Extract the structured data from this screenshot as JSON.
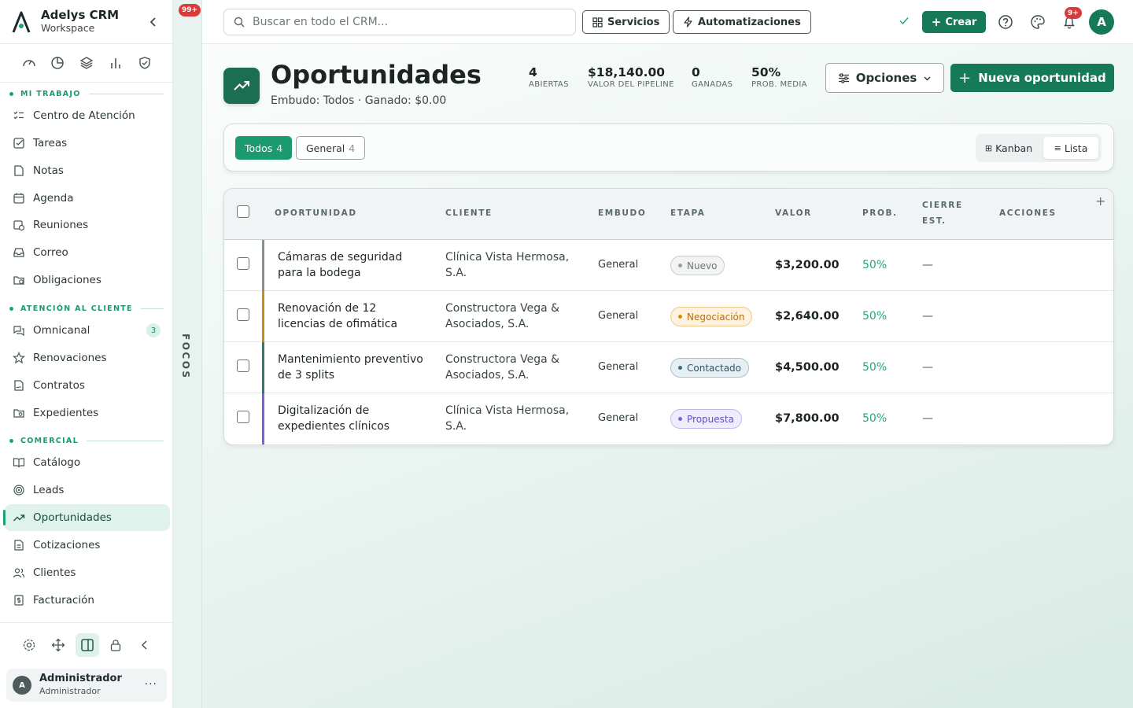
{
  "brand": {
    "title": "Adelys CRM",
    "subtitle": "Workspace"
  },
  "sections": {
    "mi_trabajo": "MI TRABAJO",
    "atencion": "ATENCIÓN AL CLIENTE",
    "comercial": "COMERCIAL"
  },
  "nav": {
    "mi_trabajo": [
      {
        "label": "Centro de Atención",
        "icon": "list-check-icon"
      },
      {
        "label": "Tareas",
        "icon": "checkbox-icon"
      },
      {
        "label": "Notas",
        "icon": "note-icon"
      },
      {
        "label": "Agenda",
        "icon": "calendar-icon"
      },
      {
        "label": "Reuniones",
        "icon": "calendar-clock-icon"
      },
      {
        "label": "Correo",
        "icon": "inbox-icon"
      },
      {
        "label": "Obligaciones",
        "icon": "folder-clock-icon"
      }
    ],
    "atencion": [
      {
        "label": "Omnicanal",
        "icon": "chat-icon",
        "badge": "3"
      },
      {
        "label": "Renovaciones",
        "icon": "star-icon"
      },
      {
        "label": "Contratos",
        "icon": "contract-icon"
      },
      {
        "label": "Expedientes",
        "icon": "folder-search-icon"
      }
    ],
    "comercial": [
      {
        "label": "Catálogo",
        "icon": "book-icon"
      },
      {
        "label": "Leads",
        "icon": "target-icon"
      },
      {
        "label": "Oportunidades",
        "icon": "trending-up-icon",
        "active": true
      },
      {
        "label": "Cotizaciones",
        "icon": "file-icon"
      },
      {
        "label": "Clientes",
        "icon": "users-icon"
      },
      {
        "label": "Facturación",
        "icon": "invoice-icon"
      }
    ]
  },
  "user": {
    "initial": "A",
    "name": "Administrador",
    "role": "Administrador",
    "more": "···"
  },
  "focus": {
    "badge": "99+",
    "label": "FOCOS"
  },
  "topbar": {
    "search_placeholder": "Buscar en todo el CRM...",
    "servicios": "Servicios",
    "automatizaciones": "Automatizaciones",
    "crear": "Crear",
    "notif_badge": "9+",
    "avatar": "A"
  },
  "page": {
    "title": "Oportunidades",
    "subtitle": "Embudo: Todos · Ganado: $0.00",
    "stats": [
      {
        "value": "4",
        "label": "ABIERTAS"
      },
      {
        "value": "$18,140.00",
        "label": "VALOR DEL PIPELINE"
      },
      {
        "value": "0",
        "label": "GANADAS"
      },
      {
        "value": "50%",
        "label": "PROB. MEDIA"
      }
    ],
    "opciones": "Opciones",
    "nueva": "Nueva oportunidad"
  },
  "filters": {
    "chips": [
      {
        "label": "Todos",
        "count": "4"
      },
      {
        "label": "General",
        "count": "4"
      }
    ],
    "views": {
      "kanban": "Kanban",
      "lista": "Lista"
    }
  },
  "table": {
    "headers": {
      "oportunidad": "OPORTUNIDAD",
      "cliente": "CLIENTE",
      "embudo": "EMBUDO",
      "etapa": "ETAPA",
      "valor": "VALOR",
      "prob": "PROB.",
      "cierre_1": "CIERRE",
      "cierre_2": "EST.",
      "acciones": "ACCIONES"
    },
    "rows": [
      {
        "opportunity": "Cámaras de seguridad para la bodega",
        "client": "Clínica Vista Hermosa, S.A.",
        "funnel": "General",
        "stage": "Nuevo",
        "value": "$3,200.00",
        "prob": "50%",
        "close": "—",
        "bar_color": "#8a8f8f",
        "stage_bg": "#f2f3f3",
        "stage_border": "#c9cccc",
        "stage_color": "#6f7575",
        "stage_dot": "#9aa0a0"
      },
      {
        "opportunity": "Renovación de 12 licencias de ofimática",
        "client": "Constructora Vega & Asociados, S.A.",
        "funnel": "General",
        "stage": "Negociación",
        "value": "$2,640.00",
        "prob": "50%",
        "close": "—",
        "bar_color": "#c88a1e",
        "stage_bg": "#fdf1e1",
        "stage_border": "#efc88a",
        "stage_color": "#b3700f",
        "stage_dot": "#d98a16"
      },
      {
        "opportunity": "Mantenimiento preventivo de 3 splits",
        "client": "Constructora Vega & Asociados, S.A.",
        "funnel": "General",
        "stage": "Contactado",
        "value": "$4,500.00",
        "prob": "50%",
        "close": "—",
        "bar_color": "#2f7a6e",
        "stage_bg": "#e6eff3",
        "stage_border": "#a9c1cc",
        "stage_color": "#2e5666",
        "stage_dot": "#336f86"
      },
      {
        "opportunity": "Digitalización de expedientes clínicos",
        "client": "Clínica Vista Hermosa, S.A.",
        "funnel": "General",
        "stage": "Propuesta",
        "value": "$7,800.00",
        "prob": "50%",
        "close": "—",
        "bar_color": "#7a63d6",
        "stage_bg": "#efecfb",
        "stage_border": "#c4b8f0",
        "stage_color": "#6150c0",
        "stage_dot": "#7563d8"
      }
    ]
  }
}
